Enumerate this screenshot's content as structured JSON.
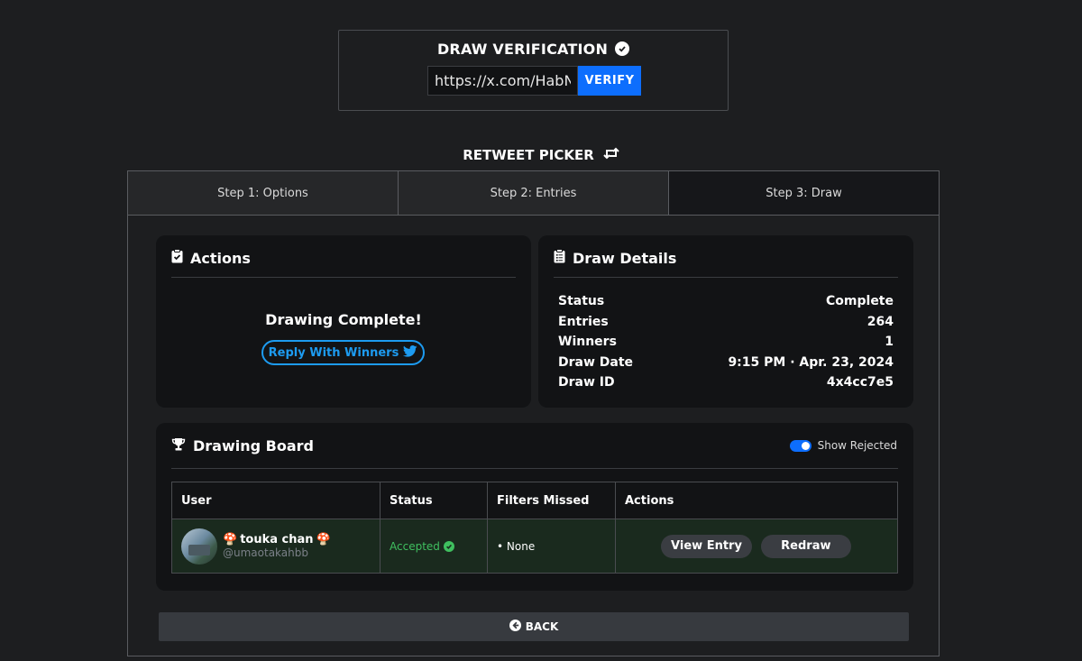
{
  "verification": {
    "title": "DRAW VERIFICATION",
    "url_value": "https://x.com/HabNu",
    "verify_label": "VERIFY"
  },
  "picker": {
    "title": "RETWEET PICKER"
  },
  "tabs": [
    {
      "label": "Step 1: Options"
    },
    {
      "label": "Step 2: Entries"
    },
    {
      "label": "Step 3: Draw",
      "active": true
    }
  ],
  "actions": {
    "title": "Actions",
    "status_text": "Drawing Complete!",
    "reply_label": "Reply With Winners"
  },
  "details": {
    "title": "Draw Details",
    "rows": [
      {
        "label": "Status",
        "value": "Complete"
      },
      {
        "label": "Entries",
        "value": "264"
      },
      {
        "label": "Winners",
        "value": "1"
      },
      {
        "label": "Draw Date",
        "value": "9:15 PM · Apr. 23, 2024"
      },
      {
        "label": "Draw ID",
        "value": "4x4cc7e5"
      }
    ]
  },
  "board": {
    "title": "Drawing Board",
    "toggle_label": "Show Rejected",
    "toggle_on": true,
    "columns": [
      "User",
      "Status",
      "Filters Missed",
      "Actions"
    ],
    "rows": [
      {
        "name": "touka chan",
        "handle": "@umaotakahbb",
        "status": "Accepted",
        "filters_missed": "• None",
        "view_label": "View Entry",
        "redraw_label": "Redraw"
      }
    ]
  },
  "back_label": "BACK",
  "colors": {
    "background": "#1d1e20",
    "accent": "#0d6efd",
    "twitter": "#1d9bf0",
    "accepted": "#3fbf5f"
  }
}
